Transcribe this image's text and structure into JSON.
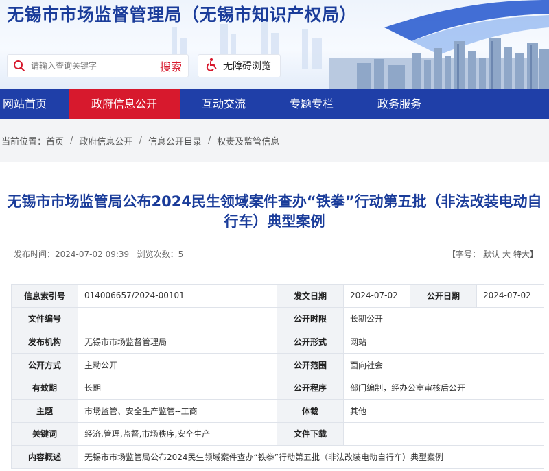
{
  "site": {
    "title": "无锡市市场监督管理局（无锡市知识产权局）",
    "search_placeholder": "请输入查询关键字",
    "search_button": "搜索",
    "accessibility": "无障碍浏览"
  },
  "nav": {
    "items": [
      {
        "label": "网站首页",
        "active": false
      },
      {
        "label": "政府信息公开",
        "active": true
      },
      {
        "label": "互动交流",
        "active": false
      },
      {
        "label": "专题专栏",
        "active": false
      },
      {
        "label": "政务服务",
        "active": false
      }
    ]
  },
  "breadcrumb": {
    "prefix": "当前位置：",
    "items": [
      "首页",
      "政府信息公开",
      "信息公开目录",
      "权责及监管信息"
    ],
    "separator": "/"
  },
  "article": {
    "title": "无锡市市场监管局公布2024民生领域案件查办“铁拳”行动第五批（非法改装电动自行车）典型案例",
    "publish_label": "发布时间：",
    "publish_time": "2024-07-02 09:39",
    "views_label": "浏览次数：",
    "views": "5",
    "font_label": "【字号：",
    "font_default": "默认",
    "font_large": "大",
    "font_xlarge": "特大】"
  },
  "info": {
    "index_label": "信息索引号",
    "index_value": "014006657/2024-00101",
    "issue_date_label": "发文日期",
    "issue_date_value": "2024-07-02",
    "open_date_label": "公开日期",
    "open_date_value": "2024-07-02",
    "doc_no_label": "文件编号",
    "doc_no_value": "",
    "open_period_label": "公开时限",
    "open_period_value": "长期公开",
    "issuer_label": "发布机构",
    "issuer_value": "无锡市市场监督管理局",
    "open_form_label": "公开形式",
    "open_form_value": "网站",
    "open_method_label": "公开方式",
    "open_method_value": "主动公开",
    "open_scope_label": "公开范围",
    "open_scope_value": "面向社会",
    "validity_label": "有效期",
    "validity_value": "长期",
    "open_proc_label": "公开程序",
    "open_proc_value": "部门编制，经办公室审核后公开",
    "topic_label": "主题",
    "topic_value": "市场监管、安全生产监管--工商",
    "genre_label": "体裁",
    "genre_value": "其他",
    "keywords_label": "关键词",
    "keywords_value": "经济,管理,监督,市场秩序,安全生产",
    "download_label": "文件下载",
    "download_value": "",
    "summary_label": "内容概述",
    "summary_value": "无锡市市场监管局公布2024民生领域案件查办“铁拳”行动第五批（非法改装电动自行车）典型案例"
  },
  "colors": {
    "primary_blue": "#1f3fa8",
    "title_blue": "#1a3c9a",
    "accent_red": "#d7192d"
  }
}
